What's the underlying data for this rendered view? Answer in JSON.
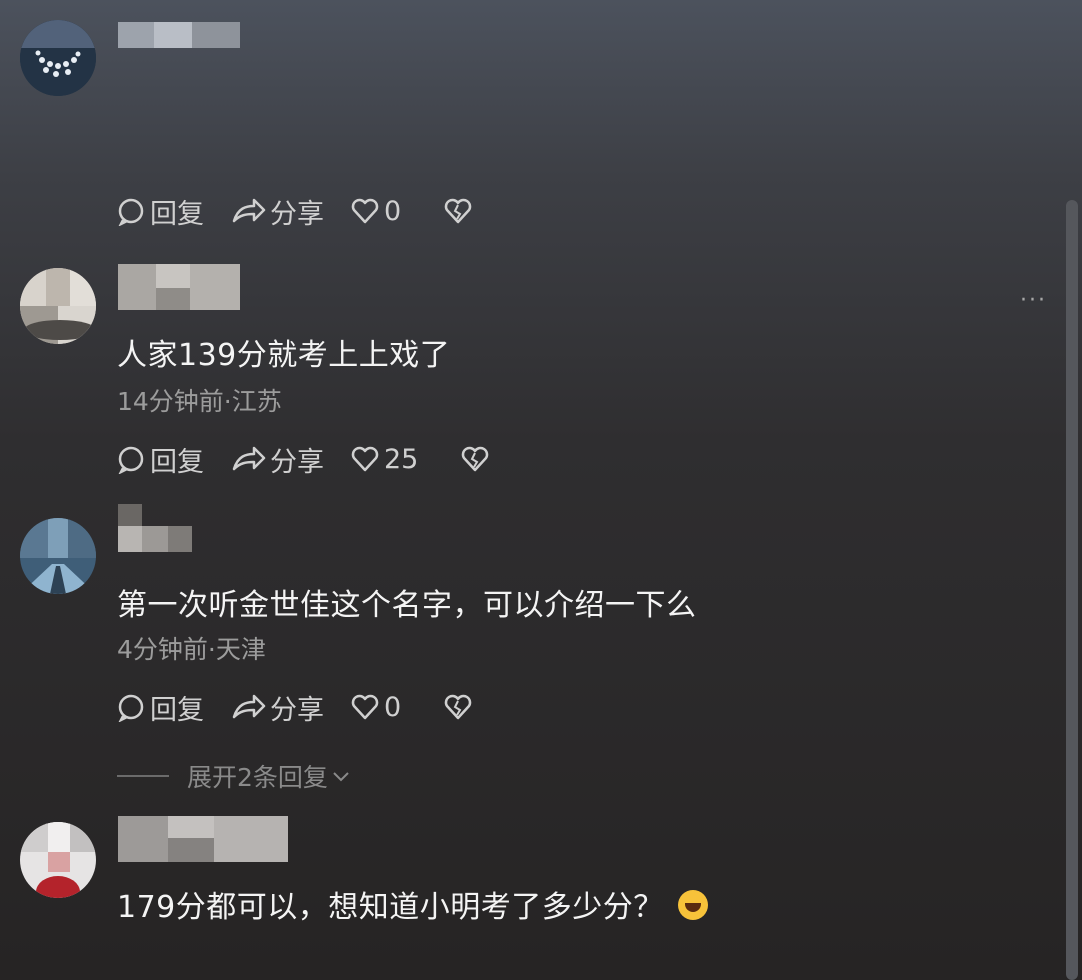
{
  "actions": {
    "reply": "回复",
    "share": "分享"
  },
  "comments": [
    {
      "text": "",
      "meta": "",
      "likes": "0"
    },
    {
      "text": "人家139分就考上上戏了",
      "meta": "14分钟前·江苏",
      "likes": "25"
    },
    {
      "text": "第一次听金世佳这个名字，可以介绍一下么",
      "meta": "4分钟前·天津",
      "likes": "0",
      "expand": "展开2条回复"
    },
    {
      "text": "179分都可以，想知道小明考了多少分？",
      "meta": "",
      "likes": ""
    }
  ],
  "more": "···",
  "colors": {
    "background_top": "#4c525d",
    "background_bottom": "#262424",
    "emoji": "#f7c23a"
  }
}
